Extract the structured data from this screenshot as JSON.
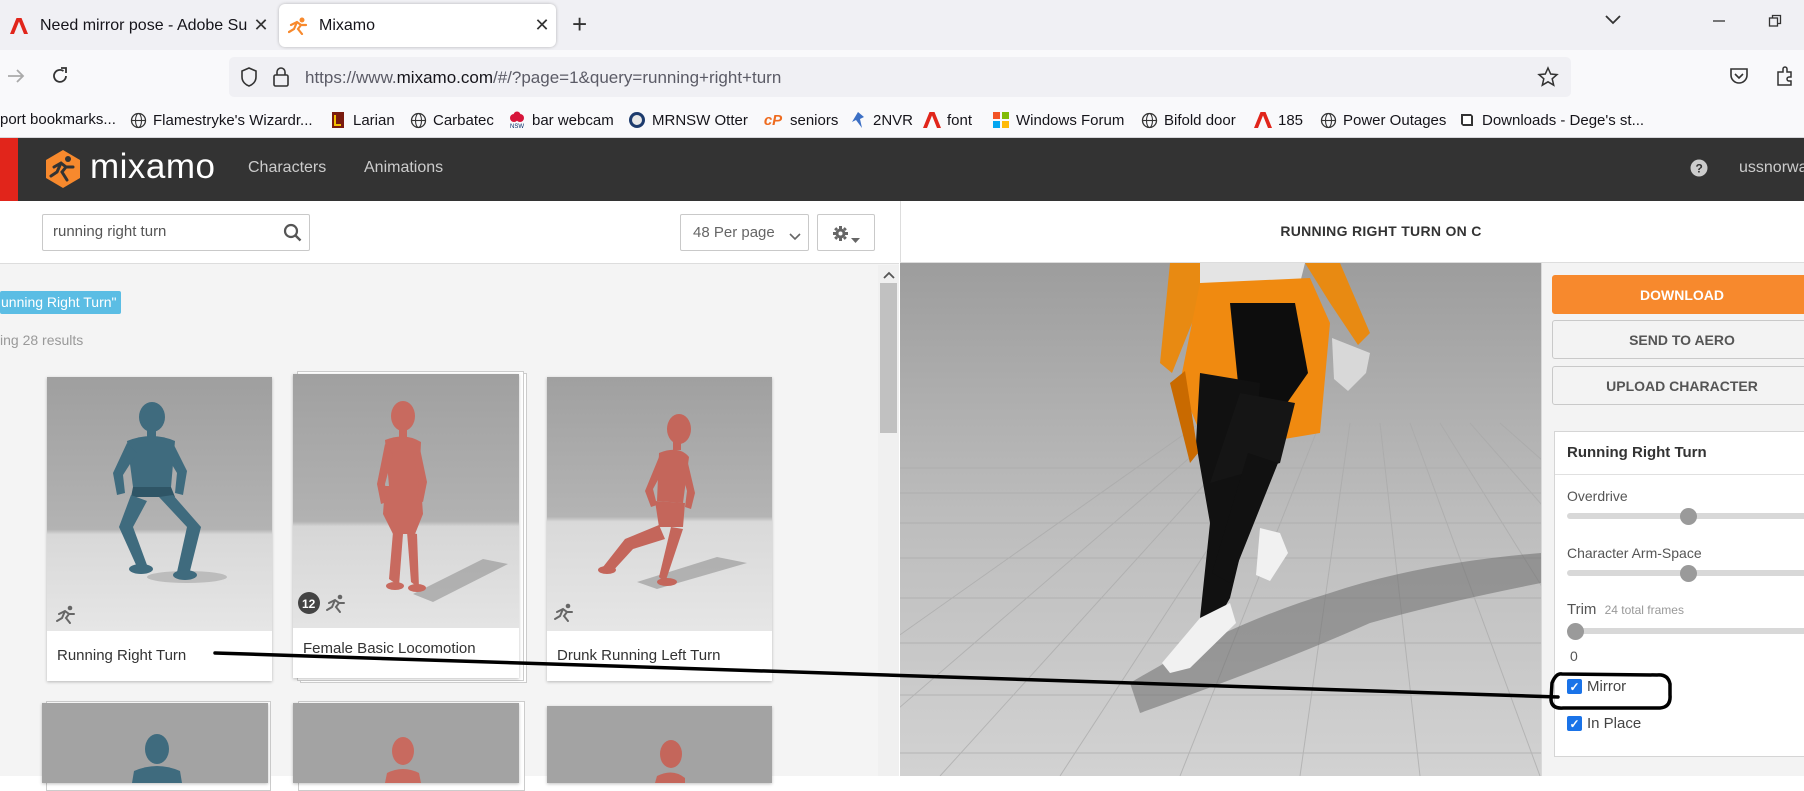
{
  "browser": {
    "tabs": [
      {
        "title": "Need mirror pose - Adobe Supp",
        "icon": "adobe-icon"
      },
      {
        "title": "Mixamo",
        "icon": "mixamo-icon",
        "active": true
      }
    ],
    "url_prefix": "https://www.",
    "url_domain": "mixamo.com",
    "url_rest": "/#/?page=1&query=running+right+turn",
    "bookmarks": [
      "port bookmarks...",
      "Flamestryke's Wizardr...",
      "Larian",
      "Carbatec",
      "bar webcam",
      "MRNSW Otter",
      "seniors",
      "2NVR",
      "font",
      "Windows Forum",
      "Bifold door",
      "185",
      "Power Outages",
      "Downloads - Dege's st..."
    ]
  },
  "app": {
    "logo": "mixamo",
    "nav": [
      "Characters",
      "Animations"
    ],
    "help_icon": "question-icon",
    "user": "ussnorwa"
  },
  "search": {
    "value": "running right turn",
    "per_page": "48 Per page"
  },
  "results": {
    "chip": "unning Right Turn\"",
    "count_text": "ing 28 results",
    "cards": [
      {
        "caption": "Running Right Turn",
        "badge": ""
      },
      {
        "caption": "Female Basic Locomotion",
        "badge": "12"
      },
      {
        "caption": "Drunk Running Left Turn",
        "badge": ""
      }
    ]
  },
  "preview": {
    "title": "RUNNING RIGHT TURN ON C",
    "buttons": [
      "DOWNLOAD",
      "SEND TO AERO",
      "UPLOAD CHARACTER"
    ],
    "panel_title": "Running Right Turn",
    "sliders": [
      {
        "label": "Overdrive",
        "value": 0.5
      },
      {
        "label": "Character Arm-Space",
        "value": 0.5
      },
      {
        "label": "Trim",
        "sub": "24 total frames",
        "value": 0.0
      }
    ],
    "trim_value": "0",
    "checkboxes": [
      {
        "label": "Mirror",
        "checked": true
      },
      {
        "label": "In Place",
        "checked": true
      }
    ]
  },
  "colors": {
    "accent_orange": "#f7892d",
    "header_bg": "#333333",
    "chip_blue": "#5bbde4",
    "checkbox_blue": "#1a73e8"
  }
}
